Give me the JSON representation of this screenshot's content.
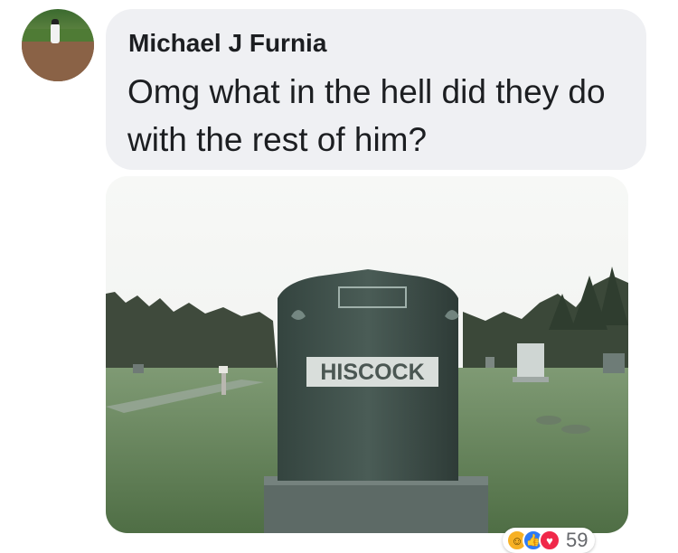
{
  "comment": {
    "author": "Michael J Furnia",
    "text": "Omg what in the hell did they do with the rest of him?"
  },
  "photo": {
    "headstone_text": "HISCOCK"
  },
  "reactions": {
    "icons": [
      "haha-icon",
      "like-icon",
      "love-icon"
    ],
    "count": "59"
  },
  "colors": {
    "bubble": "#eff0f3",
    "text": "#1c1e21",
    "like": "#2e7bf6",
    "love": "#f0284a",
    "haha": "#f7b125"
  }
}
